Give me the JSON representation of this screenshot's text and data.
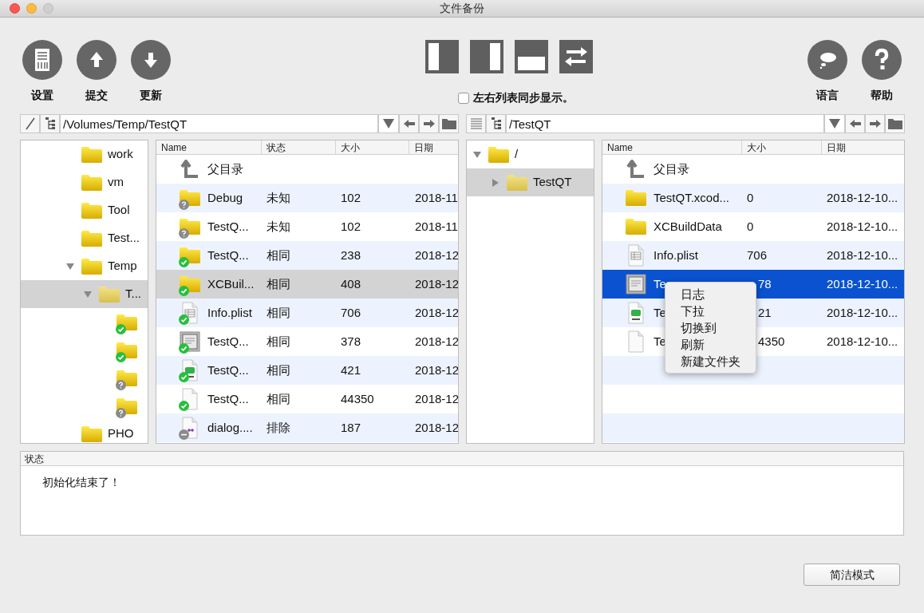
{
  "window": {
    "title": "文件备份"
  },
  "toolbar": {
    "left_buttons": [
      {
        "kind": "settings",
        "label": "设置"
      },
      {
        "kind": "upload",
        "label": "提交"
      },
      {
        "kind": "download",
        "label": "更新"
      }
    ],
    "layout_buttons": [
      {
        "kind": "left"
      },
      {
        "kind": "right"
      },
      {
        "kind": "bottom"
      },
      {
        "kind": "swap"
      }
    ],
    "sync_checkbox": {
      "label": "左右列表同步显示。",
      "checked": false
    },
    "right_buttons": [
      {
        "kind": "language",
        "label": "语言"
      },
      {
        "kind": "help",
        "label": "帮助"
      }
    ]
  },
  "panes": [
    {
      "path_bar": {
        "kind": "slash",
        "value": "/Volumes/Temp/TestQT"
      },
      "tree": [
        {
          "label": "work"
        },
        {
          "label": "vm"
        },
        {
          "label": "Tool"
        },
        {
          "label": "Test..."
        },
        {
          "label": "Temp",
          "expanded": true,
          "selected": false,
          "children": [
            {
              "label": "T...",
              "expanded": true,
              "selected": true,
              "children": [
                {
                  "synced": true
                },
                {
                  "synced": true
                },
                {
                  "synced": false
                },
                {
                  "synced": false
                }
              ]
            }
          ]
        },
        {
          "label": "PHO"
        }
      ],
      "table": {
        "columns": [
          "Name",
          "状态",
          "大小",
          "日期"
        ],
        "rows": [
          {
            "kind": "up",
            "cells": [
              "父目录"
            ],
            "selected": false
          },
          {
            "kind": "folder",
            "synced": false,
            "excluded": false,
            "cells": [
              "Debug",
              "未知",
              "102",
              "2018-11"
            ],
            "selected": false
          },
          {
            "kind": "folder",
            "synced": false,
            "excluded": false,
            "cells": [
              "TestQ...",
              "未知",
              "102",
              "2018-11"
            ],
            "selected": false
          },
          {
            "kind": "folder",
            "synced": true,
            "excluded": false,
            "cells": [
              "TestQ...",
              "相同",
              "238",
              "2018-12"
            ],
            "selected": false
          },
          {
            "kind": "folder",
            "synced": true,
            "excluded": false,
            "cells": [
              "XCBuil...",
              "相同",
              "408",
              "2018-12"
            ],
            "selected": true
          },
          {
            "kind": "plist",
            "synced": true,
            "excluded": false,
            "cells": [
              "Info.plist",
              "相同",
              "706",
              "2018-12"
            ],
            "selected": false
          },
          {
            "kind": "image",
            "synced": true,
            "excluded": false,
            "cells": [
              "TestQ...",
              "相同",
              "378",
              "2018-12"
            ],
            "selected": false
          },
          {
            "kind": "pro",
            "synced": true,
            "excluded": false,
            "cells": [
              "TestQ...",
              "相同",
              "421",
              "2018-12"
            ],
            "selected": false
          },
          {
            "kind": "blank",
            "synced": true,
            "excluded": false,
            "cells": [
              "TestQ...",
              "相同",
              "44350",
              "2018-12"
            ],
            "selected": false
          },
          {
            "kind": "cpp",
            "synced": false,
            "excluded": true,
            "cells": [
              "dialog....",
              "排除",
              "187",
              "2018-12"
            ],
            "selected": false
          }
        ]
      }
    },
    {
      "path_bar": {
        "kind": "list",
        "value": "/TestQT"
      },
      "tree": [
        {
          "label": "/",
          "expanded": true,
          "selected": false,
          "children": [
            {
              "label": "TestQT",
              "expanded": false,
              "selected": true
            }
          ]
        }
      ],
      "table": {
        "columns": [
          "Name",
          "大小",
          "日期"
        ],
        "rows": [
          {
            "kind": "up",
            "cells": [
              "父目录"
            ],
            "selected": false
          },
          {
            "kind": "folder",
            "cells": [
              "TestQT.xcod...",
              "0",
              "2018-12-10..."
            ],
            "selected": false
          },
          {
            "kind": "folder",
            "cells": [
              "XCBuildData",
              "0",
              "2018-12-10..."
            ],
            "selected": false
          },
          {
            "kind": "plist",
            "cells": [
              "Info.plist",
              "706",
              "2018-12-10..."
            ],
            "selected": false
          },
          {
            "kind": "image",
            "covered": true,
            "cells": [
              "Te",
              "78",
              "2018-12-10..."
            ],
            "selected": true
          },
          {
            "kind": "pro",
            "covered": true,
            "cells": [
              "Te",
              "21",
              "2018-12-10..."
            ],
            "selected": false
          },
          {
            "kind": "blank",
            "covered": true,
            "cells": [
              "Te",
              "4350",
              "2018-12-10..."
            ],
            "selected": false
          }
        ]
      }
    }
  ],
  "context_menu": {
    "items": [
      "日志",
      "下拉",
      "切换到",
      "刷新",
      "新建文件夹"
    ]
  },
  "status": {
    "title": "状态",
    "message": "初始化结束了！"
  },
  "buttons": [
    {
      "label": "简洁模式"
    }
  ]
}
